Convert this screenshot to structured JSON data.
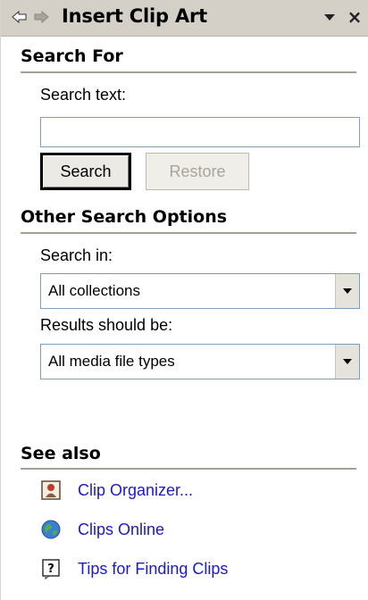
{
  "pane": {
    "title": "Insert Clip Art"
  },
  "search_for": {
    "heading": "Search For",
    "search_text_label": "Search text:",
    "search_text_value": "",
    "search_button": "Search",
    "restore_button": "Restore"
  },
  "other_options": {
    "heading": "Other Search Options",
    "search_in_label": "Search in:",
    "search_in_value": "All collections",
    "results_label": "Results should be:",
    "results_value": "All media file types"
  },
  "see_also": {
    "heading": "See also",
    "links": [
      {
        "label": "Clip Organizer...",
        "icon": "clip-organizer-icon"
      },
      {
        "label": "Clips Online",
        "icon": "globe-icon"
      },
      {
        "label": "Tips for Finding Clips",
        "icon": "help-icon"
      }
    ]
  },
  "colors": {
    "titlebar": "#d4d0c8",
    "link": "#1a1acc",
    "disabled_text": "#a9a49a",
    "input_border": "#7f9db9"
  }
}
